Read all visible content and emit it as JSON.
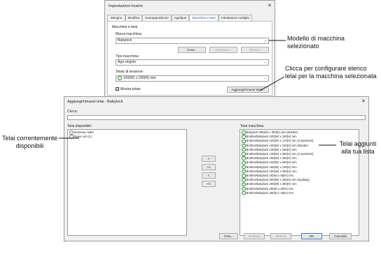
{
  "settings_dialog": {
    "title": "Impostazioni ricamo",
    "close_glyph": "✕",
    "tabs": [
      "Disegno",
      "Modifica",
      "Sovrapposizione",
      "Appliqué",
      "Macchine e telai",
      "Intelaiatura multipla"
    ],
    "active_tab": "Macchine e telai",
    "group_label": "Macchine e telai",
    "brand_label": "Marca macchina:",
    "brand_value": "Babylock",
    "buttons_row": {
      "create": "Crea...",
      "rename": "Rinomina...",
      "delete": "Elimina"
    },
    "type_label": "Tipo macchina:",
    "type_value": "Ago singolo",
    "hoop_label": "Telaio di tensione:",
    "hoop_value": "100(W) x 100(H) mm",
    "show_hoop": "Mostra telaio",
    "add_remove_button": "Aggiungi/rimuovi telai..."
  },
  "hoops_dialog": {
    "title": "Aggiungi/rimuovi telai - Babylock",
    "close_glyph": "✕",
    "search_label": "Cerca:",
    "available_label": "Telai disponibili:",
    "available_items": [
      "Nouveau cadre",
      "Nuevo aro (1)"
    ],
    "machine_label": "Telai macchina:",
    "machine_items": [
      "Babylock 300(W) x 300(H) mm (Border)",
      "Brother/Babylock 100(W) x 100(H) mm",
      "Brother/Babylock 100(W) x 172(H) mm (3 posizioni)",
      "Brother/Babylock 100(W) x 100(H) mm (Border)",
      "Brother/Babylock 130(W) x 180(H) mm",
      "Brother/Babylock 130(W) x 300(H) mm (3 posizioni)",
      "Brother/Babylock 150(W) x 150(H) mm",
      "Brother/Babylock 160(W) x 260(H) mm",
      "Brother/Babylock 180(W) x 130(H) mm",
      "Brother/Babylock 200(W) x 200(H) mm",
      "Brother/Babylock 20(W) x 60(H) mm",
      "Brother/Babylock 200(W) x 200(H) mm (Quilting)",
      "Brother/Babylock 200(W) x 300(H) mm",
      "Brother/Babylock 30(W) x 50(H) mm",
      "Brother/Babylock 40(W) x 30(H) mm"
    ],
    "transfer_buttons": [
      ">",
      ">>",
      "<",
      "<<"
    ],
    "bottom_buttons": {
      "create": "Crea...",
      "modify": "Modifica",
      "delete": "Elimina",
      "ok": "OK",
      "cancel": "Cancella"
    }
  },
  "callouts": {
    "machine": "Modello di macchina selezionato",
    "configure": "Clicca per configurare elenco telai per la macchina selezionata",
    "available": "Telai correntemente disponibili",
    "added": "Telai aggiunti alla tua lista"
  },
  "colors": {
    "active_tab_text": "#1a5fb4",
    "hoop_icon": "#1b8a1b",
    "dialog_bg": "#f0f0f0"
  }
}
